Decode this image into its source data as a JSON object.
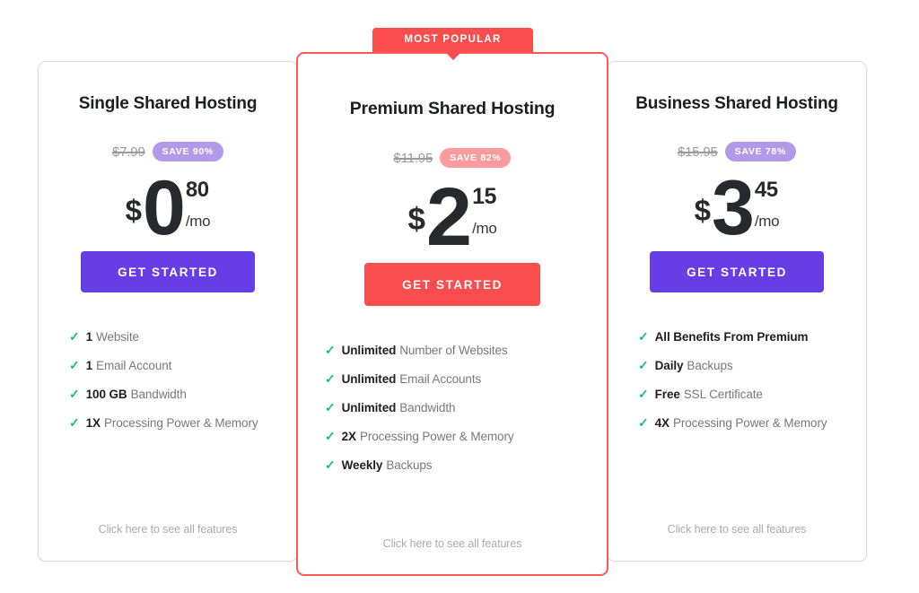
{
  "page": {
    "background": "#ffffff",
    "accent_purple": "#673de6",
    "accent_red": "#fb4d4d",
    "check_green": "#14c07d",
    "badge_purple": "#b39ae8",
    "badge_red": "#fb9b9b"
  },
  "ribbon": {
    "label": "MOST POPULAR"
  },
  "plans": [
    {
      "id": "single",
      "title": "Single Shared Hosting",
      "old_price": "$7.99",
      "save_label": "SAVE 90%",
      "save_style": "purple",
      "currency": "$",
      "whole": "0",
      "cents": "80",
      "period": "/mo",
      "cta_label": "GET STARTED",
      "cta_style": "purple",
      "features": [
        {
          "strong": "1",
          "rest": "Website"
        },
        {
          "strong": "1",
          "rest": "Email Account"
        },
        {
          "strong": "100 GB",
          "rest": "Bandwidth"
        },
        {
          "strong": "1X",
          "rest": "Processing Power & Memory"
        }
      ],
      "see_all_label": "Click here to see all features"
    },
    {
      "id": "premium",
      "title": "Premium Shared Hosting",
      "old_price": "$11.95",
      "save_label": "SAVE 82%",
      "save_style": "red",
      "currency": "$",
      "whole": "2",
      "cents": "15",
      "period": "/mo",
      "cta_label": "GET STARTED",
      "cta_style": "red",
      "features": [
        {
          "strong": "Unlimited",
          "rest": "Number of Websites"
        },
        {
          "strong": "Unlimited",
          "rest": "Email Accounts"
        },
        {
          "strong": "Unlimited",
          "rest": "Bandwidth"
        },
        {
          "strong": "2X",
          "rest": "Processing Power & Memory"
        },
        {
          "strong": "Weekly",
          "rest": "Backups"
        }
      ],
      "see_all_label": "Click here to see all features"
    },
    {
      "id": "business",
      "title": "Business Shared Hosting",
      "old_price": "$15.95",
      "save_label": "SAVE 78%",
      "save_style": "purple",
      "currency": "$",
      "whole": "3",
      "cents": "45",
      "period": "/mo",
      "cta_label": "GET STARTED",
      "cta_style": "purple",
      "features": [
        {
          "strong": "All Benefits From Premium",
          "rest": ""
        },
        {
          "strong": "Daily",
          "rest": "Backups"
        },
        {
          "strong": "Free",
          "rest": "SSL Certificate"
        },
        {
          "strong": "4X",
          "rest": "Processing Power & Memory"
        }
      ],
      "see_all_label": "Click here to see all features"
    }
  ],
  "icons": {
    "check": "check-icon"
  }
}
